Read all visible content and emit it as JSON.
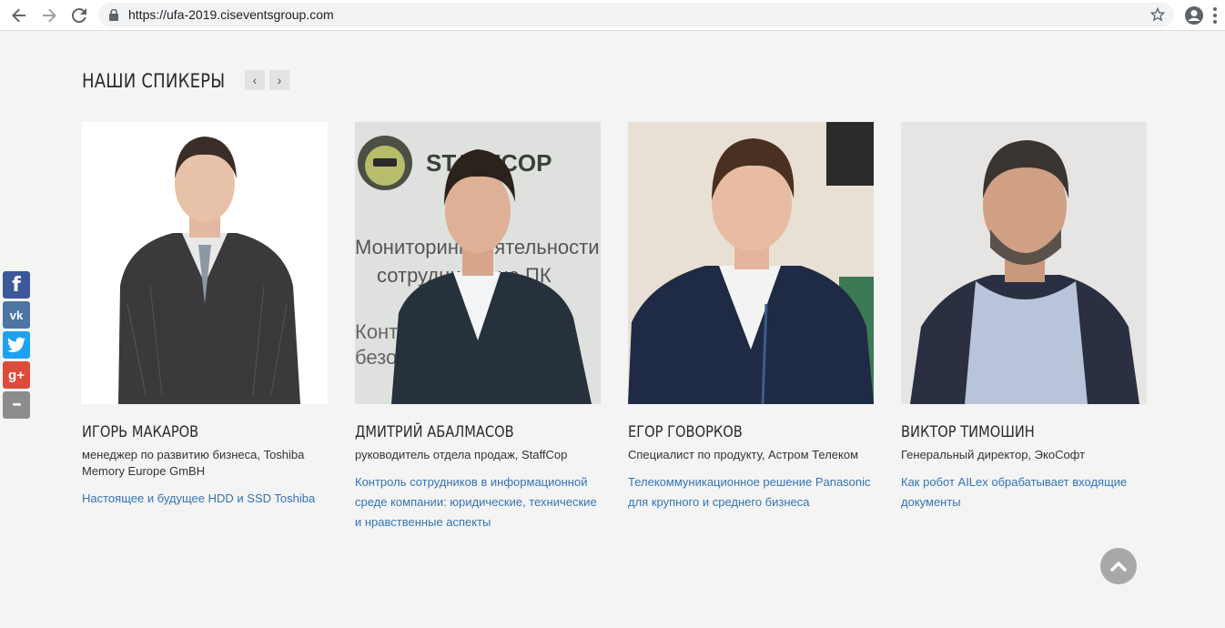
{
  "browser": {
    "url": "https://ufa-2019.ciseventsgroup.com",
    "icons": [
      "back-icon",
      "forward-icon",
      "reload-icon",
      "lock-icon",
      "star-icon",
      "account-icon",
      "menu-icon"
    ]
  },
  "section": {
    "title": "НАШИ СПИКЕРЫ",
    "prev": "‹",
    "next": "›"
  },
  "speakers": [
    {
      "name": "ИГОРЬ МАКАРОВ",
      "role": "менеджер по развитию бизнеса, Toshiba Memory Europe GmBH",
      "talk": "Настоящее и будущее HDD и SSD Toshiba"
    },
    {
      "name": "ДМИТРИЙ АБАЛМАСОВ",
      "role": "руководитель отдела продаж, StaffCop",
      "talk": "Контроль сотрудников в информационной среде компании: юридические, технические и нравственные аспекты",
      "photo_text": {
        "logo": "SТАFFCOP",
        "line1": "Мониторинг деятельности",
        "line2": "сотрудников на ПК",
        "line3": "Контроль",
        "line4": "безо"
      }
    },
    {
      "name": "ЕГОР ГОВОРКОВ",
      "role": "Специалист по продукту, Астром Телеком",
      "talk": "Телекоммуникационное решение Panasonic для крупного и среднего бизнеса"
    },
    {
      "name": "ВИКТОР ТИМОШИН",
      "role": "Генеральный директор, ЭкоСофт",
      "talk": "Как робот AILex обрабатывает входящие документы"
    }
  ],
  "social": [
    {
      "icon": "facebook-icon",
      "glyph": "f",
      "color": "#3b5998"
    },
    {
      "icon": "vk-icon",
      "glyph": "vk",
      "color": "#4c75a3"
    },
    {
      "icon": "twitter-icon",
      "glyph": "t",
      "color": "#1da1f2"
    },
    {
      "icon": "google-plus-icon",
      "glyph": "g+",
      "color": "#dd4b39"
    },
    {
      "icon": "more-icon",
      "glyph": "•••",
      "color": "#8c8c8c"
    }
  ],
  "scroll_top": {
    "icon": "chevron-up-icon"
  },
  "colors": {
    "link": "#3474b5",
    "background": "#f4f4f4"
  }
}
